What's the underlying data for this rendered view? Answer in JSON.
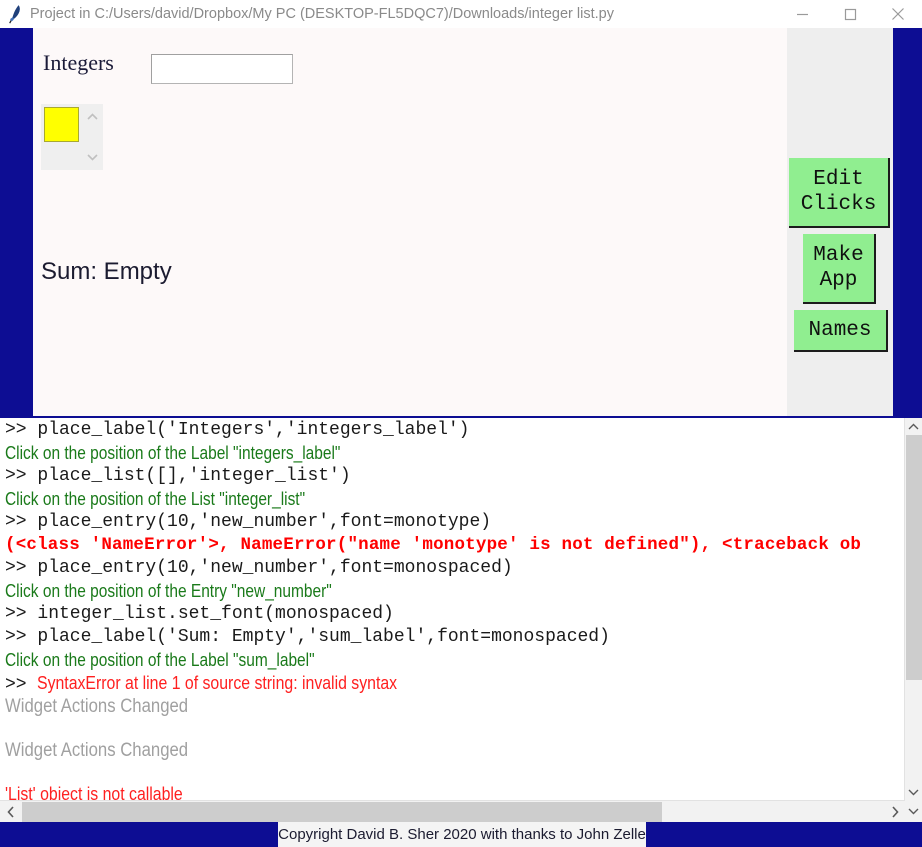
{
  "window": {
    "title": "Project in C:/Users/david/Dropbox/My PC (DESKTOP-FL5DQC7)/Downloads/integer list.py",
    "icon": "python-feather-icon",
    "minimize_label": "—",
    "maximize_label": "□",
    "close_label": "✕",
    "frame_color": "#0d0d93",
    "canvas_color": "#fdf9f9",
    "panel_color": "#eeeeee"
  },
  "designer": {
    "integers_label": "Integers",
    "new_number_entry": "",
    "new_number_placeholder": "",
    "list_selected_color": "#ffff00",
    "sum_label": "Sum: Empty",
    "buttons": [
      {
        "name": "edit-clicks",
        "label": "Edit\nClicks",
        "color": "#90ee90"
      },
      {
        "name": "make-app",
        "label": "Make\nApp",
        "color": "#90ee90"
      },
      {
        "name": "names",
        "label": "Names",
        "color": "#90ee90"
      }
    ]
  },
  "console": {
    "lines": [
      {
        "style": "mono",
        "text": ">> place_label('Integers','integers_label')"
      },
      {
        "style": "green",
        "text": "Click on the position of the Label \"integers_label\""
      },
      {
        "style": "mono",
        "text": ">> place_list([],'integer_list')"
      },
      {
        "style": "green",
        "text": "Click on the position of the List \"integer_list\""
      },
      {
        "style": "mono",
        "text": ">> place_entry(10,'new_number',font=monotype)"
      },
      {
        "style": "err-mono",
        "text": "(<class 'NameError'>, NameError(\"name 'monotype' is not defined\"), <traceback ob"
      },
      {
        "style": "mono",
        "text": ">> place_entry(10,'new_number',font=monospaced)"
      },
      {
        "style": "green",
        "text": "Click on the position of the Entry \"new_number\""
      },
      {
        "style": "mono",
        "text": ">> integer_list.set_font(monospaced)"
      },
      {
        "style": "mono",
        "text": ">> place_label('Sum: Empty','sum_label',font=monospaced)"
      },
      {
        "style": "green",
        "text": "Click on the position of the Label \"sum_label\""
      },
      {
        "style": "redmix",
        "prefix": ">> ",
        "text": "SyntaxError at line 1 of source string: invalid syntax"
      },
      {
        "style": "gray",
        "text": "Widget Actions Changed"
      },
      {
        "style": "spacer",
        "text": ""
      },
      {
        "style": "gray",
        "text": "Widget Actions Changed"
      },
      {
        "style": "spacer",
        "text": ""
      },
      {
        "style": "red",
        "text": "'List' object is not callable"
      }
    ]
  },
  "scrollbars": {
    "vertical_up": "∧",
    "vertical_down": "∨",
    "horizontal_left": "‹",
    "horizontal_right": "›",
    "corner_down": "∨"
  },
  "footer": {
    "copyright": "Copyright David B. Sher 2020 with thanks to John Zelle"
  }
}
